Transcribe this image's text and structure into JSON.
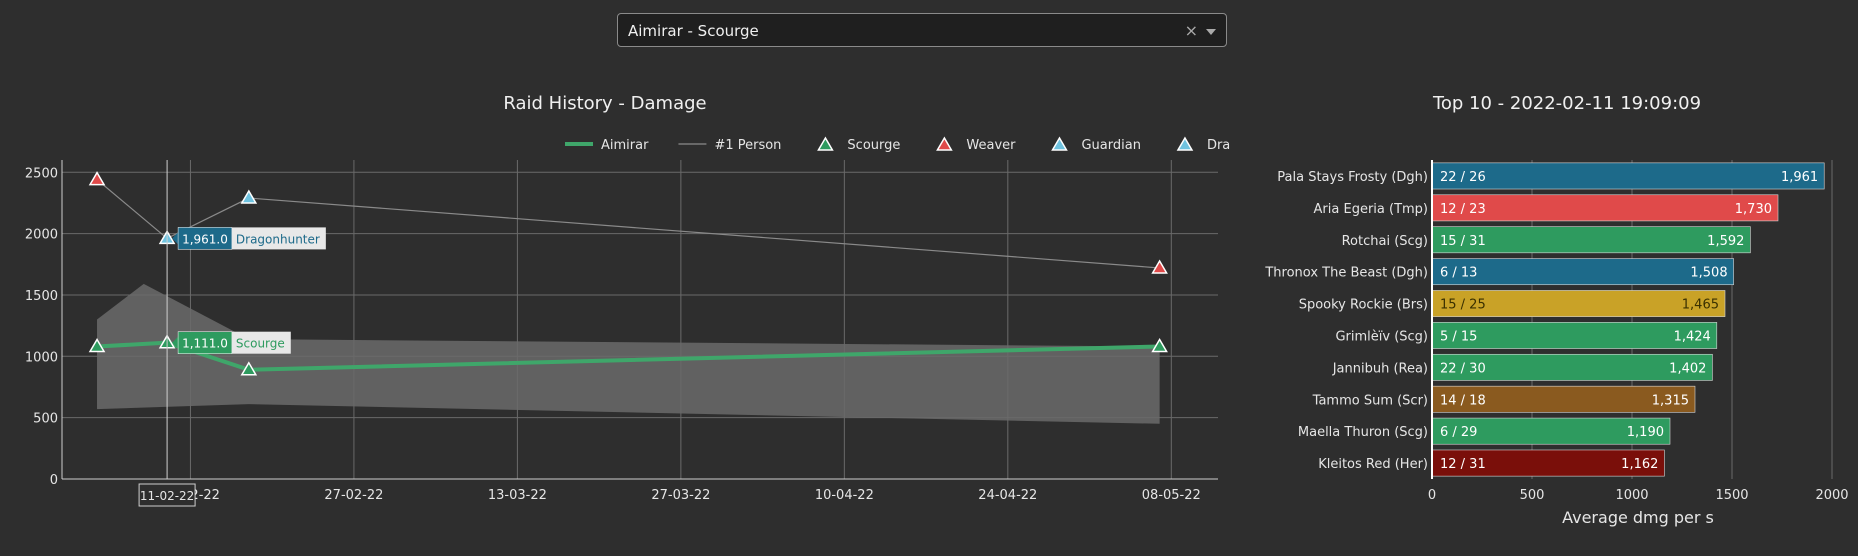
{
  "selector": {
    "value": "Aimirar - Scourge",
    "clear_icon": "close-icon",
    "caret_icon": "chevron-down-icon"
  },
  "history": {
    "title": "Raid History - Damage",
    "legend": [
      {
        "name": "Aimirar",
        "kind": "line",
        "color": "#3fa66a"
      },
      {
        "name": "#1 Person",
        "kind": "thin",
        "color": "#8a8a8a"
      },
      {
        "name": "Scourge",
        "kind": "tri",
        "color": "#2e9b5f"
      },
      {
        "name": "Weaver",
        "kind": "tri",
        "color": "#e04a4a"
      },
      {
        "name": "Guardian",
        "kind": "tri",
        "color": "#6fc3e0"
      },
      {
        "name": "Dragonhunter",
        "kind": "tri",
        "color": "#6fc3e0"
      }
    ],
    "hover_x_label": "11-02-22",
    "tooltips": [
      {
        "value": "1,961.0",
        "label": "Dragonhunter",
        "color": "#1d6a8a",
        "x": "2022-02-11",
        "y": 1961
      },
      {
        "value": "1,111.0",
        "label": "Scourge",
        "color": "#2e9b5f",
        "x": "2022-02-11",
        "y": 1111
      }
    ]
  },
  "top10": {
    "title": "Top 10 - 2022-02-11 19:09:09",
    "xlabel": "Average dmg per s"
  },
  "chart_data": [
    {
      "type": "line",
      "x_tick_labels": [
        "13-02-22",
        "27-02-22",
        "13-03-22",
        "27-03-22",
        "10-04-22",
        "24-04-22",
        "08-05-22"
      ],
      "x_tick_dates": [
        "2022-02-13",
        "2022-02-27",
        "2022-03-13",
        "2022-03-27",
        "2022-04-10",
        "2022-04-24",
        "2022-05-08"
      ],
      "xlim": [
        "2022-02-02",
        "2022-05-12"
      ],
      "ylim": [
        0,
        2600
      ],
      "y_ticks": [
        0,
        500,
        1000,
        1500,
        2000,
        2500
      ],
      "grid": true,
      "legend_position": "top-right",
      "series": [
        {
          "name": "Aimirar",
          "color": "#3fa66a",
          "points": [
            [
              "2022-02-05",
              1080
            ],
            [
              "2022-02-11",
              1111
            ],
            [
              "2022-02-18",
              890
            ],
            [
              "2022-05-07",
              1080
            ]
          ]
        },
        {
          "name": "#1 Person",
          "color": "#8a8a8a",
          "points": [
            [
              "2022-02-05",
              2440
            ],
            [
              "2022-02-11",
              1961
            ],
            [
              "2022-02-18",
              2290
            ],
            [
              "2022-05-07",
              1720
            ]
          ]
        }
      ],
      "band": {
        "upper": [
          [
            "2022-02-05",
            1300
          ],
          [
            "2022-02-09",
            1590
          ],
          [
            "2022-02-18",
            1140
          ],
          [
            "2022-05-07",
            1080
          ]
        ],
        "lower": [
          [
            "2022-02-05",
            570
          ],
          [
            "2022-02-18",
            610
          ],
          [
            "2022-05-07",
            450
          ]
        ]
      },
      "markers": [
        {
          "name": "Scourge",
          "color": "#2e9b5f",
          "points": [
            [
              "2022-02-05",
              1080
            ],
            [
              "2022-02-11",
              1111
            ],
            [
              "2022-02-18",
              890
            ],
            [
              "2022-05-07",
              1080
            ]
          ]
        },
        {
          "name": "Weaver",
          "color": "#e04a4a",
          "points": [
            [
              "2022-02-05",
              2440
            ],
            [
              "2022-05-07",
              1720
            ]
          ]
        },
        {
          "name": "Guardian",
          "color": "#6fc3e0",
          "points": [
            [
              "2022-02-18",
              2290
            ]
          ]
        },
        {
          "name": "Dragonhunter",
          "color": "#6fc3e0",
          "points": [
            [
              "2022-02-11",
              1961
            ]
          ]
        }
      ]
    },
    {
      "type": "bar",
      "orientation": "horizontal",
      "xlim": [
        0,
        2000
      ],
      "x_ticks": [
        0,
        500,
        1000,
        1500,
        2000
      ],
      "xlabel": "Average dmg per s",
      "categories": [
        "Pala Stays Frosty (Dgh)",
        "Aria Egeria (Tmp)",
        "Rotchai (Scg)",
        "Thronox The Beast (Dgh)",
        "Spooky Rockie (Brs)",
        "Grimlèïv (Scg)",
        "Jannibuh (Rea)",
        "Tammo Sum (Scr)",
        "Maella Thuron (Scg)",
        "Kleitos Red (Her)"
      ],
      "values": [
        1961,
        1730,
        1592,
        1508,
        1465,
        1424,
        1402,
        1315,
        1190,
        1162
      ],
      "value_labels": [
        "1,961",
        "1,730",
        "1,592",
        "1,508",
        "1,465",
        "1,424",
        "1,402",
        "1,315",
        "1,190",
        "1,162"
      ],
      "ranks": [
        "22 / 26",
        "12 / 23",
        "15 / 31",
        "6 / 13",
        "15 / 25",
        "5 / 15",
        "22 / 30",
        "14 / 18",
        "6 / 29",
        "12 / 31"
      ],
      "colors": [
        "#1d6a8a",
        "#e04a4a",
        "#2e9b5f",
        "#1d6a8a",
        "#c9a227",
        "#2e9b5f",
        "#2e9b5f",
        "#8a5a1f",
        "#2e9b5f",
        "#7a0f0a"
      ],
      "text_colors": [
        "#ffffff",
        "#ffffff",
        "#ffffff",
        "#ffffff",
        "#3a3000",
        "#ffffff",
        "#ffffff",
        "#ffffff",
        "#ffffff",
        "#ffffff"
      ]
    }
  ]
}
